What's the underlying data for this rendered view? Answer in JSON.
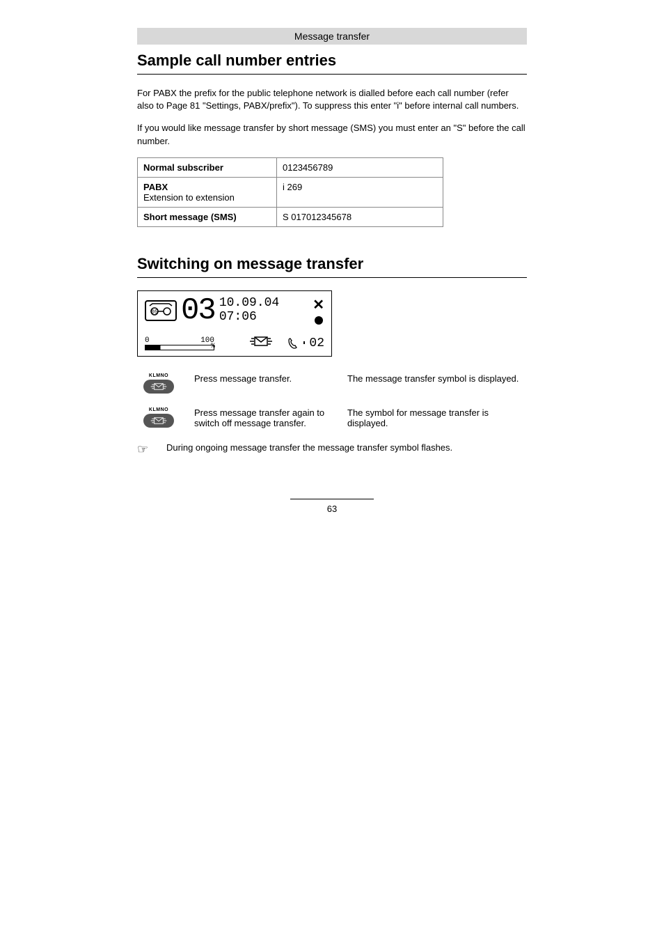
{
  "header": {
    "title": "Message transfer"
  },
  "section1": {
    "heading": "Sample call number entries",
    "para1": "For PABX the prefix for the public telephone network is dialled before each call number (refer also to Page 81 \"Settings, PABX/prefix\"). To suppress this enter \"i\" before internal call numbers.",
    "para2": "If you would like message transfer by short message (SMS) you must enter an \"S\" before the call number."
  },
  "table": {
    "rows": [
      {
        "label": "Normal subscriber",
        "sublabel": "",
        "value": "0123456789"
      },
      {
        "label": "PABX",
        "sublabel": "Extension to extension",
        "value": "i 269"
      },
      {
        "label": "Short message (SMS)",
        "sublabel": "",
        "value": "S 017012345678"
      }
    ]
  },
  "section2": {
    "heading": "Switching on message transfer"
  },
  "display": {
    "tape_num": "05",
    "big_num": "03",
    "date": "10.09.04",
    "time": "07:06",
    "gauge_min": "0",
    "gauge_max": "100",
    "gauge_pct": "%",
    "handset_count": "02"
  },
  "steps": [
    {
      "btn_label": "KLMNO",
      "icon": "message-transfer-icon",
      "action": "Press message transfer.",
      "result": "The message transfer symbol is displayed."
    },
    {
      "btn_label": "KLMNO",
      "icon": "message-transfer-icon",
      "action": "Press message transfer again to switch off message transfer.",
      "result": "The symbol for message transfer is displayed."
    }
  ],
  "note": "During ongoing message transfer the message transfer symbol flashes.",
  "page_number": "63"
}
